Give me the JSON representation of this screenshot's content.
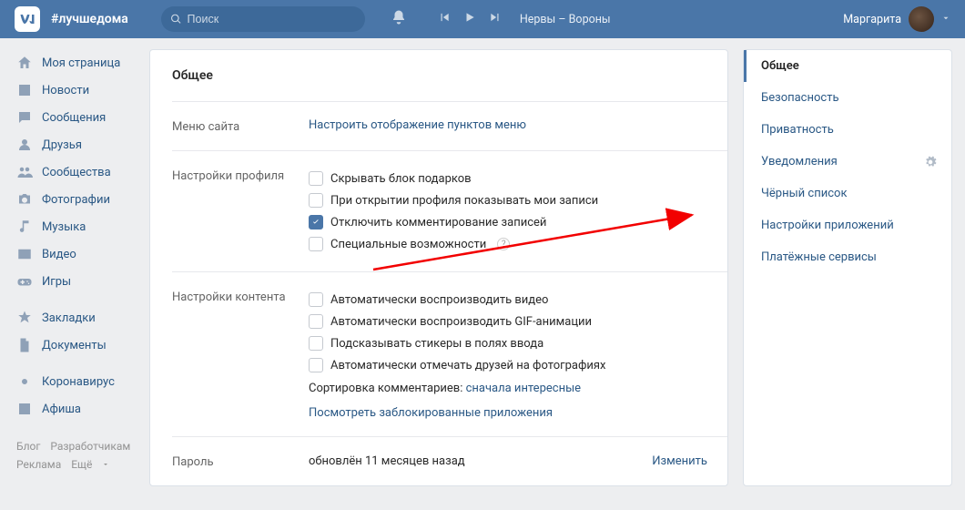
{
  "header": {
    "slogan": "#лучшедома",
    "search_placeholder": "Поиск",
    "track": "Нервы – Вороны",
    "user_name": "Маргарита"
  },
  "nav": {
    "items": [
      "Моя страница",
      "Новости",
      "Сообщения",
      "Друзья",
      "Сообщества",
      "Фотографии",
      "Музыка",
      "Видео",
      "Игры"
    ],
    "items2": [
      "Закладки",
      "Документы"
    ],
    "items3": [
      "Коронавирус",
      "Афиша"
    ]
  },
  "footer": {
    "blog": "Блог",
    "dev": "Разработчикам",
    "ads": "Реклама",
    "more": "Ещё"
  },
  "content": {
    "title": "Общее",
    "sections": {
      "menu": {
        "label": "Меню сайта",
        "link": "Настроить отображение пунктов меню"
      },
      "profile": {
        "label": "Настройки профиля",
        "checks": [
          {
            "label": "Скрывать блок подарков",
            "checked": false
          },
          {
            "label": "При открытии профиля показывать мои записи",
            "checked": false
          },
          {
            "label": "Отключить комментирование записей",
            "checked": true
          },
          {
            "label": "Специальные возможности",
            "checked": false,
            "help": true
          }
        ]
      },
      "content_s": {
        "label": "Настройки контента",
        "checks": [
          {
            "label": "Автоматически воспроизводить видео",
            "checked": false
          },
          {
            "label": "Автоматически воспроизводить GIF-анимации",
            "checked": false
          },
          {
            "label": "Подсказывать стикеры в полях ввода",
            "checked": false
          },
          {
            "label": "Автоматически отмечать друзей на фотографиях",
            "checked": false
          }
        ],
        "sort_label": "Сортировка комментариев: ",
        "sort_value": "сначала интересные",
        "blocked_link": "Посмотреть заблокированные приложения"
      },
      "password": {
        "label": "Пароль",
        "value": "обновлён 11 месяцев назад",
        "action": "Изменить"
      }
    }
  },
  "side_tabs": [
    "Общее",
    "Безопасность",
    "Приватность",
    "Уведомления",
    "Чёрный список",
    "Настройки приложений",
    "Платёжные сервисы"
  ]
}
